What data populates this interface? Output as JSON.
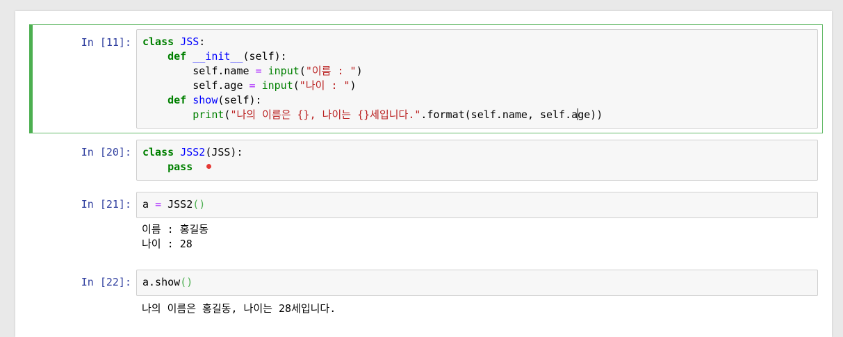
{
  "cells": [
    {
      "prompt": "In [11]:",
      "lines": [
        [
          "class",
          " ",
          "JSS",
          ":"
        ],
        [
          "    ",
          "def",
          " ",
          "__init__",
          "(self):"
        ],
        [
          "        self.name ",
          "=",
          " ",
          "input",
          "(",
          "\"이름 : \"",
          ")"
        ],
        [
          "        self.age ",
          "=",
          " ",
          "input",
          "(",
          "\"나이 : \"",
          ")"
        ],
        [
          "    ",
          "def",
          " ",
          "show",
          "(self):"
        ],
        [
          "        ",
          "print",
          "(",
          "\"나의 이름은 {}, 나이는 {}세입니다.\"",
          ".format(self.name, self.a",
          "ge))"
        ]
      ]
    },
    {
      "prompt": "In [20]:",
      "lines": [
        [
          "class",
          " ",
          "JSS2",
          "(JSS):"
        ],
        [
          "    ",
          "pass"
        ]
      ]
    },
    {
      "prompt": "In [21]:",
      "lines": [
        [
          "a ",
          "=",
          " JSS2",
          "()"
        ]
      ],
      "output": [
        "이름 : 홍길동",
        "나이 : 28"
      ]
    },
    {
      "prompt": "In [22]:",
      "lines": [
        [
          "a.show",
          "()"
        ]
      ],
      "output": [
        "나의 이름은 홍길동, 나이는 28세입니다."
      ]
    }
  ]
}
